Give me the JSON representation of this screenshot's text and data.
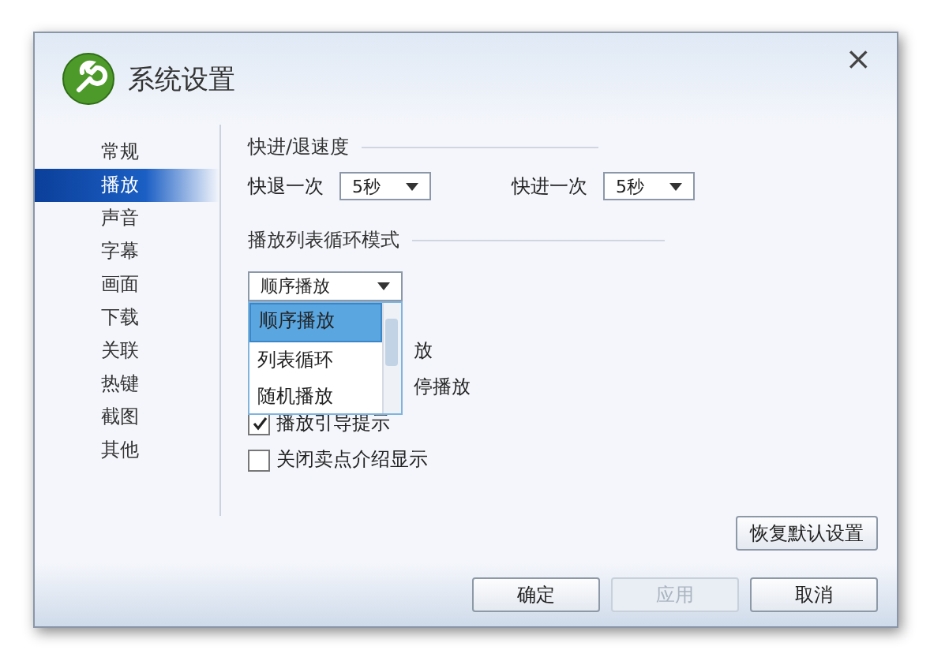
{
  "window": {
    "title": "系统设置",
    "close": "×"
  },
  "sidebar": {
    "items": [
      {
        "label": "常规",
        "selected": false
      },
      {
        "label": "播放",
        "selected": true
      },
      {
        "label": "声音",
        "selected": false
      },
      {
        "label": "字幕",
        "selected": false
      },
      {
        "label": "画面",
        "selected": false
      },
      {
        "label": "下载",
        "selected": false
      },
      {
        "label": "关联",
        "selected": false
      },
      {
        "label": "热键",
        "selected": false
      },
      {
        "label": "截图",
        "selected": false
      },
      {
        "label": "其他",
        "selected": false
      }
    ]
  },
  "speed": {
    "title": "快进/退速度",
    "fields": [
      {
        "label": "快退一次",
        "value": "5秒"
      },
      {
        "label": "快进一次",
        "value": "5秒"
      }
    ]
  },
  "loop": {
    "title": "播放列表循环模式",
    "value": "顺序播放",
    "options": [
      {
        "label": "顺序播放",
        "selected": true
      },
      {
        "label": "列表循环",
        "selected": false
      },
      {
        "label": "随机播放",
        "selected": false
      }
    ]
  },
  "options": [
    {
      "kind": "covered",
      "label": "放"
    },
    {
      "kind": "covered",
      "label": "停播放"
    },
    {
      "kind": "checkbox",
      "label": "播放引导提示",
      "checked": true
    },
    {
      "kind": "checkbox",
      "label": "关闭卖点介绍显示",
      "checked": false
    }
  ],
  "restore_button": "恢复默认设置",
  "buttons": [
    {
      "label": "确定",
      "disabled": false
    },
    {
      "label": "应用",
      "disabled": true
    },
    {
      "label": "取消",
      "disabled": false
    }
  ]
}
